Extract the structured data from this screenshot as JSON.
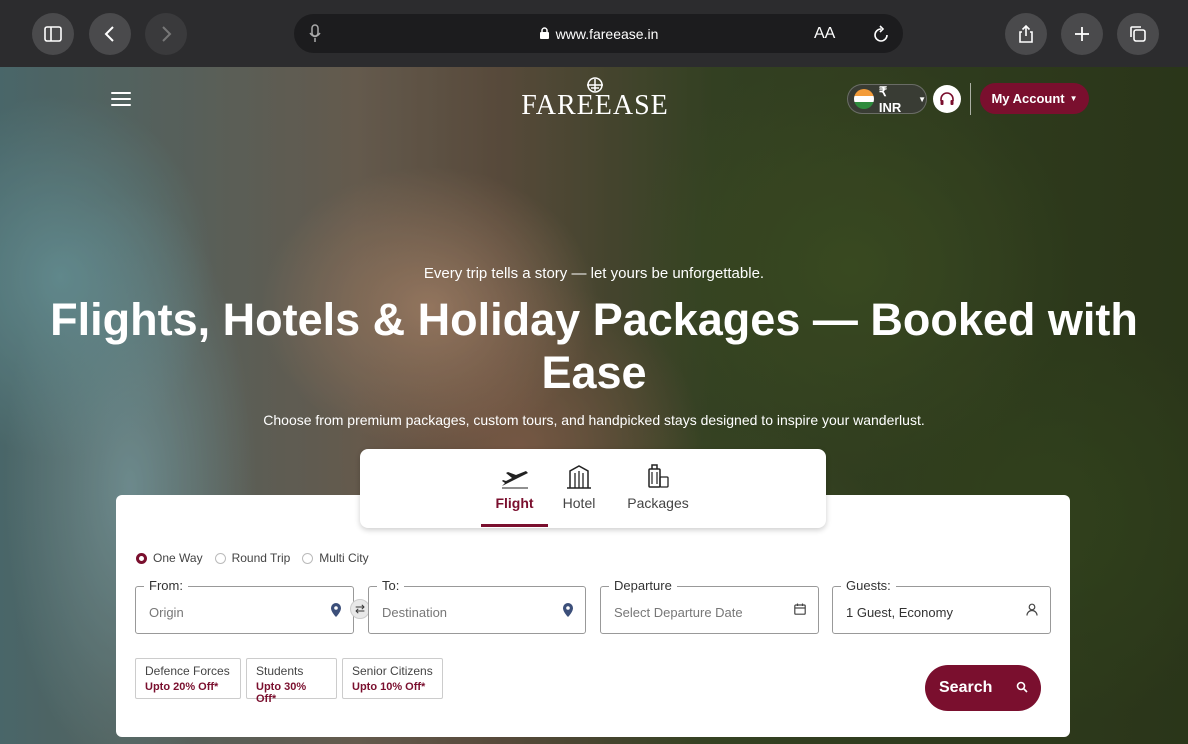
{
  "browser": {
    "url": "www.fareease.in",
    "text_size_label": "AA"
  },
  "header": {
    "logo_text": "FAREEASE",
    "currency": "₹ INR",
    "account_label": "My Account"
  },
  "hero": {
    "tagline": "Every trip tells a story — let yours be unforgettable.",
    "headline": "Flights, Hotels & Holiday Packages — Booked with Ease",
    "subline": "Choose from premium packages, custom tours, and handpicked stays designed to inspire your wanderlust."
  },
  "tabs": [
    {
      "label": "Flight",
      "icon": "plane-icon",
      "active": true
    },
    {
      "label": "Hotel",
      "icon": "building-icon",
      "active": false
    },
    {
      "label": "Packages",
      "icon": "luggage-icon",
      "active": false
    }
  ],
  "trip_types": [
    "One Way",
    "Round Trip",
    "Multi City"
  ],
  "selected_trip_type": "One Way",
  "fields": {
    "from": {
      "label": "From:",
      "placeholder": "Origin"
    },
    "to": {
      "label": "To:",
      "placeholder": "Destination"
    },
    "departure": {
      "label": "Departure",
      "placeholder": "Select Departure Date"
    },
    "guests": {
      "label": "Guests:",
      "value": "1 Guest, Economy"
    }
  },
  "offers": [
    {
      "title": "Defence Forces",
      "discount": "Upto 20% Off*"
    },
    {
      "title": "Students",
      "discount": "Upto 30% Off*"
    },
    {
      "title": "Senior Citizens",
      "discount": "Upto 10% Off*"
    }
  ],
  "search_label": "Search",
  "colors": {
    "brand": "#7a0f2e",
    "chrome": "#2c2c2e"
  }
}
